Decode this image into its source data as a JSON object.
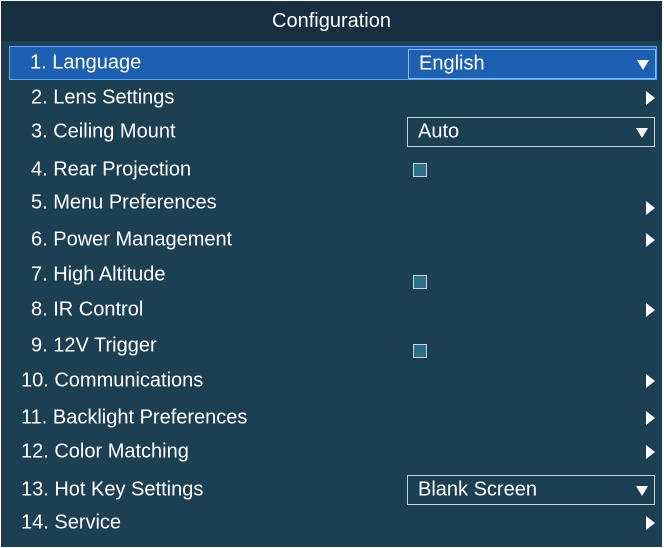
{
  "window": {
    "title": "Configuration"
  },
  "menu": {
    "items": [
      {
        "label": "1. Language",
        "control": "dropdown",
        "value": "English",
        "selected": true
      },
      {
        "label": "2. Lens Settings",
        "control": "submenu"
      },
      {
        "label": "3. Ceiling Mount",
        "control": "dropdown",
        "value": "Auto"
      },
      {
        "label": "4. Rear Projection",
        "control": "checkbox",
        "checked": false
      },
      {
        "label": "5. Menu Preferences",
        "control": "submenu"
      },
      {
        "label": "6. Power Management",
        "control": "submenu"
      },
      {
        "label": "7. High Altitude",
        "control": "checkbox",
        "checked": false
      },
      {
        "label": "8. IR Control",
        "control": "submenu"
      },
      {
        "label": "9. 12V Trigger",
        "control": "checkbox",
        "checked": false
      },
      {
        "label": "10. Communications",
        "control": "submenu"
      },
      {
        "label": "11. Backlight Preferences",
        "control": "submenu"
      },
      {
        "label": "12. Color Matching",
        "control": "submenu"
      },
      {
        "label": "13. Hot Key Settings",
        "control": "dropdown",
        "value": "Blank Screen"
      },
      {
        "label": "14. Service",
        "control": "submenu"
      }
    ]
  },
  "colors": {
    "background": "#1c3f54",
    "titlebar": "#152f40",
    "highlight": "#1d5fb0",
    "text": "#ffffff"
  },
  "icons": {
    "submenu": "chevron-right-icon",
    "dropdown": "caret-down-icon",
    "checkbox": "checkbox-icon"
  }
}
